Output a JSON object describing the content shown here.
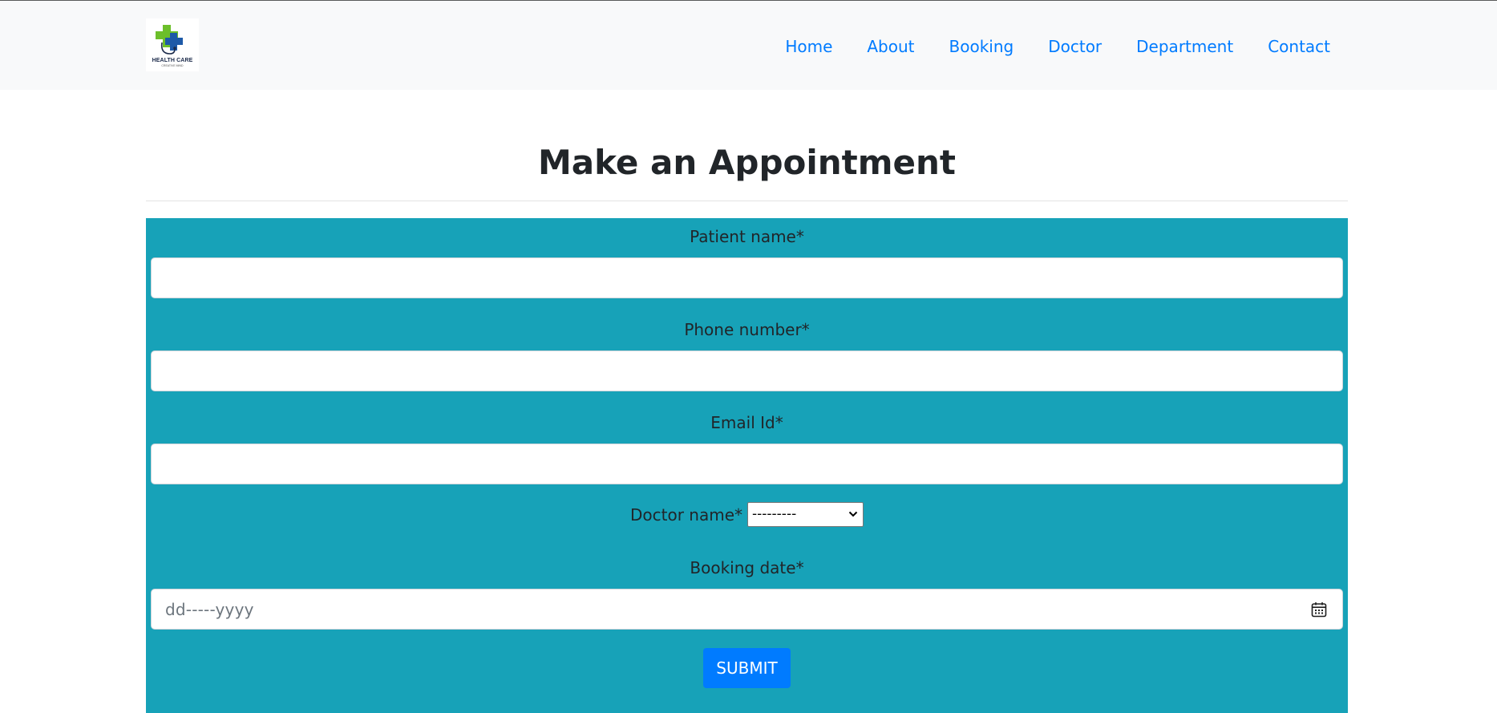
{
  "brand": {
    "name": "HEALTH CARE",
    "tagline": "CREATIVE MIND"
  },
  "nav": {
    "items": [
      {
        "label": "Home"
      },
      {
        "label": "About"
      },
      {
        "label": "Booking"
      },
      {
        "label": "Doctor"
      },
      {
        "label": "Department"
      },
      {
        "label": "Contact"
      }
    ]
  },
  "page": {
    "title": "Make an Appointment"
  },
  "form": {
    "patient_name_label": "Patient name*",
    "patient_name_value": "",
    "phone_label": "Phone number*",
    "phone_value": "",
    "email_label": "Email Id*",
    "email_value": "",
    "doctor_label": "Doctor name*",
    "doctor_selected": "---------",
    "date_label": "Booking date*",
    "date_placeholder": "dd-----yyyy",
    "submit_label": "SUBMIT"
  },
  "colors": {
    "form_background": "#17a2b8",
    "link": "#007bff",
    "button": "#007bff",
    "navbar_background": "#f8f9fa",
    "logo_green": "#6cbf2a",
    "logo_blue": "#1e5aa8"
  }
}
